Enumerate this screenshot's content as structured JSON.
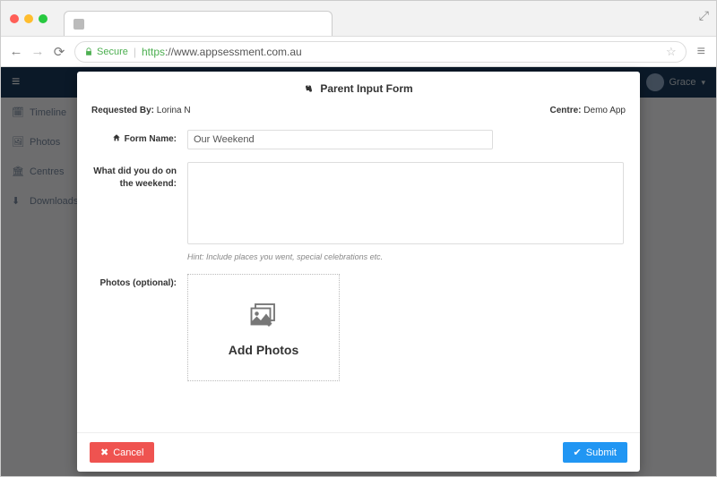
{
  "browser": {
    "secure_label": "Secure",
    "url_prefix": "https",
    "url_rest": "://www.appsessment.com.au"
  },
  "header": {
    "username": "Grace"
  },
  "sidebar": {
    "items": [
      {
        "label": "Timeline"
      },
      {
        "label": "Photos"
      },
      {
        "label": "Centres"
      },
      {
        "label": "Downloads"
      }
    ]
  },
  "modal": {
    "title": "Parent Input Form",
    "requested_by_label": "Requested By:",
    "requested_by_value": "Lorina N",
    "centre_label": "Centre:",
    "centre_value": "Demo App",
    "form_name_label": "Form Name:",
    "form_name_value": "Our Weekend",
    "weekend_label": "What did you do on the weekend:",
    "weekend_value": "",
    "hint": "Hint: Include places you went, special celebrations etc.",
    "photos_label": "Photos (optional):",
    "add_photos_label": "Add Photos",
    "cancel_label": "Cancel",
    "submit_label": "Submit"
  }
}
